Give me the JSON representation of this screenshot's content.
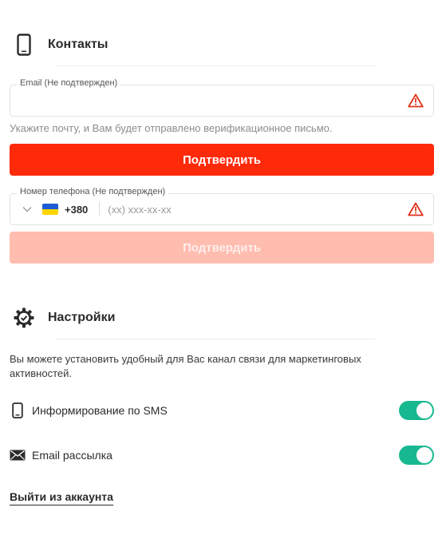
{
  "contacts": {
    "title": "Контакты",
    "icon": "smartphone-icon",
    "email": {
      "legend": "Email (Не подтвержден)",
      "value": "",
      "warning_icon": "warning-triangle-icon",
      "hint": "Укажите почту, и Вам будет отправлено верификационное письмо.",
      "confirm_label": "Подтвердить"
    },
    "phone": {
      "legend": "Номер телефона (Не подтвержден)",
      "country_flag": "ukraine-flag-icon",
      "country_code": "+380",
      "placeholder": "(xx) xxx-xx-xx",
      "value": "",
      "warning_icon": "warning-triangle-icon",
      "confirm_label": "Подтвердить",
      "confirm_enabled": false
    }
  },
  "settings": {
    "title": "Настройки",
    "icon": "gear-check-icon",
    "description": "Вы можете установить удобный для Вас канал связи для маркетинговых активностей.",
    "preferences": [
      {
        "label": "Информирование по SMS",
        "icon": "smartphone-icon",
        "enabled": true
      },
      {
        "label": "Email рассылка",
        "icon": "envelope-icon",
        "enabled": true
      }
    ]
  },
  "logout_label": "Выйти из аккаунта",
  "colors": {
    "primary": "#ff2a0a",
    "primary_disabled": "#ffbdb0",
    "toggle_on": "#17b890",
    "warning": "#e0311b"
  }
}
